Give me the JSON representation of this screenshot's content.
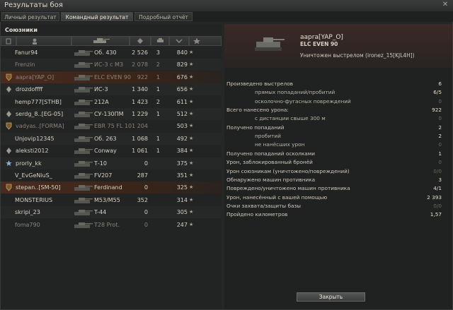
{
  "window": {
    "title": "Результаты боя",
    "close_glyph": "✕"
  },
  "tabs": [
    {
      "label": "Личный результат",
      "active": false
    },
    {
      "label": "Командный результат",
      "active": true
    },
    {
      "label": "Подробный отчёт",
      "active": false
    }
  ],
  "allies": {
    "title": "Союзники",
    "columns": [
      "squad-icon",
      "player-icon",
      "tank-icon",
      "damage-icon",
      "kills-icon",
      "experience-icon",
      "star-icon"
    ],
    "rows": [
      {
        "player": "Fanur94",
        "tank": "Об. 430",
        "damage": "2 526",
        "kills": "3",
        "exp": "840",
        "star": "★",
        "dead": false,
        "badge": ""
      },
      {
        "player": "Frenzin",
        "tank": "ИС-3 с МЗ",
        "damage": "2 078",
        "kills": "2",
        "exp": "829",
        "star": "★",
        "dead": true,
        "badge": ""
      },
      {
        "player": "aapra[YAP_O]",
        "tank": "ELC EVEN 90",
        "damage": "922",
        "kills": "1",
        "exp": "676",
        "star": "★",
        "dead": true,
        "badge": "shield",
        "highlight": true
      },
      {
        "player": "drozdoffff",
        "tank": "ИС-3",
        "damage": "1 340",
        "kills": "1",
        "exp": "656",
        "star": "★",
        "dead": false,
        "badge": "diamond"
      },
      {
        "player": "hemp777[STHB]",
        "tank": "212А",
        "damage": "1 423",
        "kills": "2",
        "exp": "611",
        "star": "★",
        "dead": false,
        "badge": ""
      },
      {
        "player": "serdg_8..[EG-05]",
        "tank": "СУ-130ПМ",
        "damage": "1 229",
        "kills": "1",
        "exp": "512",
        "star": "★",
        "dead": false,
        "badge": "diamond"
      },
      {
        "player": "vadyas..[FORMA]",
        "tank": "EBR 75 FL 10",
        "damage": "1 204",
        "kills": "",
        "exp": "503",
        "star": "★",
        "dead": true,
        "badge": "shield"
      },
      {
        "player": "Unjovip12345",
        "tank": "Об. 263",
        "damage": "1 068",
        "kills": "1",
        "exp": "492",
        "star": "★",
        "dead": false,
        "badge": ""
      },
      {
        "player": "aleksti2012",
        "tank": "Conway",
        "damage": "1 061",
        "kills": "1",
        "exp": "384",
        "star": "★",
        "dead": false,
        "badge": "diamond"
      },
      {
        "player": "prorly_kk",
        "tank": "Т-10",
        "damage": "0",
        "kills": "",
        "exp": "375",
        "star": "★",
        "dead": false,
        "badge": "star"
      },
      {
        "player": "V_EvGeNiuS_",
        "tank": "FV207",
        "damage": "287",
        "kills": "",
        "exp": "351",
        "star": "★",
        "dead": false,
        "badge": ""
      },
      {
        "player": "stepan..[SM-50]",
        "tank": "Ferdinand",
        "damage": "0",
        "kills": "",
        "exp": "325",
        "star": "★",
        "dead": false,
        "badge": "shield",
        "highlight": true
      },
      {
        "player": "MONSTERIUS",
        "tank": "M53/M55",
        "damage": "352",
        "kills": "",
        "exp": "314",
        "star": "★",
        "dead": false,
        "badge": ""
      },
      {
        "player": "skripi_23",
        "tank": "T-44",
        "damage": "0",
        "kills": "",
        "exp": "305",
        "star": "★",
        "dead": false,
        "badge": ""
      },
      {
        "player": "foma790",
        "tank": "T28 Prot.",
        "damage": "0",
        "kills": "",
        "exp": "247",
        "star": "★",
        "dead": true,
        "badge": ""
      }
    ]
  },
  "detail": {
    "player": "aapra[YAP_O]",
    "tank": "ELC EVEN 90",
    "killed_by": "Уничтожен выстрелом (ironez_15[KJL4H])",
    "stats": [
      {
        "label": "Произведено выстрелов",
        "value": "6",
        "indent": 0,
        "dim": false
      },
      {
        "label": "прямых попаданий/пробитий",
        "value": "6/5",
        "indent": 2,
        "dim": false
      },
      {
        "label": "осколочно-фугасных повреждений",
        "value": "0",
        "indent": 2,
        "dim": true
      },
      {
        "label": "Всего нанесено урона:",
        "value": "922",
        "indent": 0,
        "dim": false
      },
      {
        "label": "с дистанции свыше 300 м",
        "value": "0",
        "indent": 2,
        "dim": true
      },
      {
        "label": "Получено попаданий",
        "value": "2",
        "indent": 0,
        "dim": false
      },
      {
        "label": "пробитий",
        "value": "2",
        "indent": 2,
        "dim": false
      },
      {
        "label": "не нанёсших урон",
        "value": "0",
        "indent": 2,
        "dim": true
      },
      {
        "label": "Получено попаданий осколками",
        "value": "1",
        "indent": 0,
        "dim": false
      },
      {
        "label": "Урон, заблокированный бронёй",
        "value": "0",
        "indent": 0,
        "dim": true
      },
      {
        "label": "Урон союзникам (уничтожено/повреждений)",
        "value": "0/0",
        "indent": 0,
        "dim": true
      },
      {
        "label": "Обнаружено машин противника",
        "value": "3",
        "indent": 0,
        "dim": false
      },
      {
        "label": "Повреждено/уничтожено машин противника",
        "value": "4/1",
        "indent": 0,
        "dim": false
      },
      {
        "label": "Урон, нанесённый с вашей помощью",
        "value": "2 393",
        "indent": 0,
        "dim": false
      },
      {
        "label": "Очки захвата/защиты базы",
        "value": "0/0",
        "indent": 0,
        "dim": true
      },
      {
        "label": "Пройдено километров",
        "value": "1,57",
        "indent": 0,
        "dim": false
      }
    ],
    "close_button": "Закрыть"
  }
}
